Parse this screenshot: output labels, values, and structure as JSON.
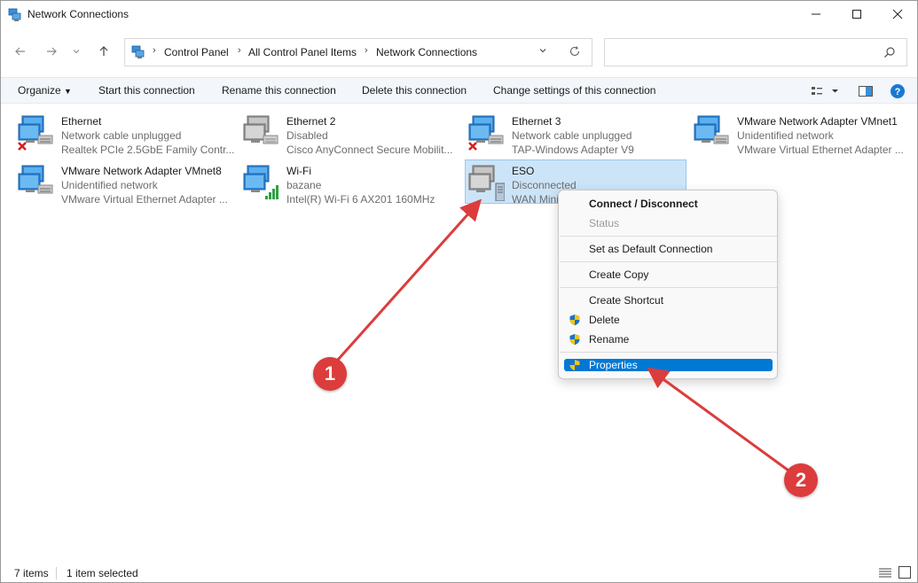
{
  "window": {
    "title": "Network Connections"
  },
  "address": {
    "crumbs": [
      "Control Panel",
      "All Control Panel Items",
      "Network Connections"
    ],
    "search_placeholder": ""
  },
  "toolbar": {
    "organize": "Organize",
    "start": "Start this connection",
    "rename": "Rename this connection",
    "delete": "Delete this connection",
    "change": "Change settings of this connection"
  },
  "items": [
    {
      "name": "Ethernet",
      "status": "Network cable unplugged",
      "device": "Realtek PCIe 2.5GbE Family Contr...",
      "icon": "network-adapter-icon",
      "badge": "red-x"
    },
    {
      "name": "Ethernet 2",
      "status": "Disabled",
      "device": "Cisco AnyConnect Secure Mobilit...",
      "icon": "network-adapter-icon",
      "badge": "none"
    },
    {
      "name": "Ethernet 3",
      "status": "Network cable unplugged",
      "device": "TAP-Windows Adapter V9",
      "icon": "network-adapter-icon",
      "badge": "red-x"
    },
    {
      "name": "VMware Network Adapter VMnet1",
      "status": "Unidentified network",
      "device": "VMware Virtual Ethernet Adapter ...",
      "icon": "network-adapter-icon",
      "badge": "none"
    },
    {
      "name": "VMware Network Adapter VMnet8",
      "status": "Unidentified network",
      "device": "VMware Virtual Ethernet Adapter ...",
      "icon": "network-adapter-icon",
      "badge": "none"
    },
    {
      "name": "Wi-Fi",
      "status": "bazane",
      "device": "Intel(R) Wi-Fi 6 AX201 160MHz",
      "icon": "wifi-adapter-icon",
      "badge": "signal"
    },
    {
      "name": "ESO",
      "status": "Disconnected",
      "device": "WAN Mini",
      "icon": "wan-adapter-icon",
      "badge": "none"
    }
  ],
  "context_menu": {
    "connect": "Connect / Disconnect",
    "status": "Status",
    "set_default": "Set as Default Connection",
    "create_copy": "Create Copy",
    "create_shortcut": "Create Shortcut",
    "delete": "Delete",
    "rename": "Rename",
    "properties": "Properties"
  },
  "status_bar": {
    "count": "7 items",
    "selected": "1 item selected"
  },
  "annotations": {
    "one": "1",
    "two": "2"
  },
  "colors": {
    "accent": "#0078d4",
    "selection": "#cce4f7",
    "annotation": "#dc3c3c"
  }
}
